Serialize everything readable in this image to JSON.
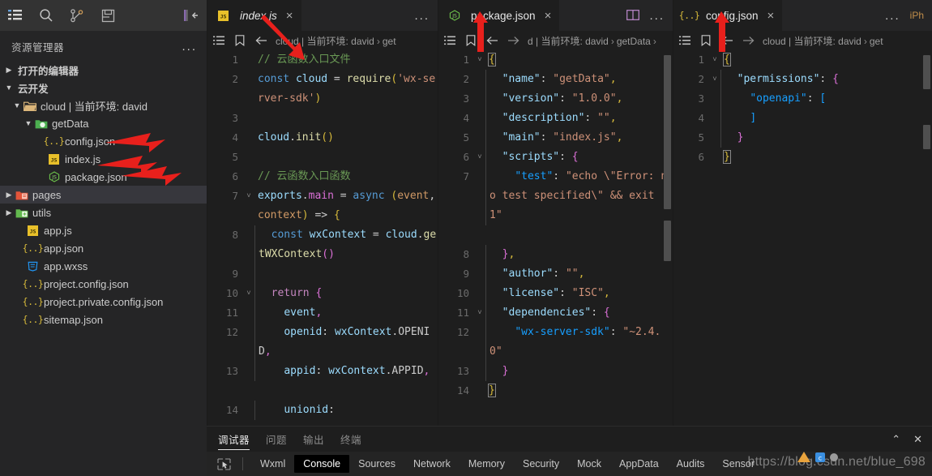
{
  "activity_bar": {
    "icons": [
      {
        "name": "explorer-icon",
        "label": "资源管理器"
      },
      {
        "name": "search-icon",
        "label": "搜索"
      },
      {
        "name": "source-control-icon",
        "label": "源代码管理"
      },
      {
        "name": "save-icon",
        "label": "保存"
      }
    ],
    "collapse_label": "折叠侧边栏"
  },
  "sidebar": {
    "title": "资源管理器",
    "more_label": "...",
    "sections": [
      {
        "label": "打开的编辑器",
        "expanded": false
      },
      {
        "label": "云开发",
        "expanded": true
      }
    ],
    "tree": [
      {
        "label": "cloud | 当前环境: david",
        "icon": "folder-open-yellow-icon",
        "depth": 1,
        "twisty": "down",
        "selected": false
      },
      {
        "label": "getData",
        "icon": "folder-open-green-icon",
        "depth": 2,
        "twisty": "down",
        "selected": false
      },
      {
        "label": "config.json",
        "icon": "json-icon",
        "depth": 3,
        "twisty": "",
        "selected": false
      },
      {
        "label": "index.js",
        "icon": "js-icon",
        "depth": 3,
        "twisty": "",
        "selected": false
      },
      {
        "label": "package.json",
        "icon": "node-icon",
        "depth": 3,
        "twisty": "",
        "selected": false
      },
      {
        "label": "pages",
        "icon": "folder-red-icon",
        "depth": 1,
        "twisty": "right",
        "selected": true
      },
      {
        "label": "utils",
        "icon": "folder-green-icon",
        "depth": 1,
        "twisty": "right",
        "selected": false
      },
      {
        "label": "app.js",
        "icon": "js-icon",
        "depth": 2,
        "twisty": "",
        "selected": false
      },
      {
        "label": "app.json",
        "icon": "json-icon",
        "depth": 2,
        "twisty": "",
        "selected": false
      },
      {
        "label": "app.wxss",
        "icon": "css-icon",
        "depth": 2,
        "twisty": "",
        "selected": false
      },
      {
        "label": "project.config.json",
        "icon": "json-icon",
        "depth": 2,
        "twisty": "",
        "selected": false
      },
      {
        "label": "project.private.config.json",
        "icon": "json-icon",
        "depth": 2,
        "twisty": "",
        "selected": false
      },
      {
        "label": "sitemap.json",
        "icon": "json-icon",
        "depth": 2,
        "twisty": "",
        "selected": false
      }
    ]
  },
  "editor_groups": [
    {
      "tab": {
        "label": "index.js",
        "icon": "js-icon",
        "active": true,
        "italic": true,
        "close": "×"
      },
      "tab_overflow": "...",
      "breadcrumb": {
        "path": "cloud | 当前环境: david",
        "sep": "›",
        "tail": "get"
      },
      "lines": [
        {
          "no": "1",
          "fold": "",
          "tokens": [
            {
              "c": "t-com",
              "t": "// 云函数入口文件"
            }
          ]
        },
        {
          "no": "2",
          "fold": "",
          "tokens": [
            {
              "c": "t-kw2",
              "t": "const"
            },
            {
              "c": "t-plain",
              "t": " "
            },
            {
              "c": "t-var",
              "t": "cloud"
            },
            {
              "c": "t-plain",
              "t": " = "
            },
            {
              "c": "t-fn",
              "t": "require"
            },
            {
              "c": "t-y",
              "t": "("
            },
            {
              "c": "t-str",
              "t": "'wx-server-sdk'"
            },
            {
              "c": "t-y",
              "t": ")"
            }
          ]
        },
        {
          "no": "3",
          "fold": "",
          "tokens": []
        },
        {
          "no": "4",
          "fold": "",
          "tokens": [
            {
              "c": "t-var",
              "t": "cloud"
            },
            {
              "c": "t-plain",
              "t": "."
            },
            {
              "c": "t-fn",
              "t": "init"
            },
            {
              "c": "t-y",
              "t": "()"
            }
          ]
        },
        {
          "no": "5",
          "fold": "",
          "tokens": []
        },
        {
          "no": "6",
          "fold": "",
          "tokens": [
            {
              "c": "t-com",
              "t": "// 云函数入口函数"
            }
          ]
        },
        {
          "no": "7",
          "fold": "v",
          "tokens": [
            {
              "c": "t-var",
              "t": "exports"
            },
            {
              "c": "t-plain",
              "t": "."
            },
            {
              "c": "t-p",
              "t": "main"
            },
            {
              "c": "t-plain",
              "t": " = "
            },
            {
              "c": "t-kw2",
              "t": "async"
            },
            {
              "c": "t-plain",
              "t": " "
            },
            {
              "c": "t-y",
              "t": "("
            },
            {
              "c": "t-orange",
              "t": "event"
            },
            {
              "c": "t-plain",
              "t": ", "
            },
            {
              "c": "t-orange",
              "t": "context"
            },
            {
              "c": "t-y",
              "t": ")"
            },
            {
              "c": "t-plain",
              "t": " => "
            },
            {
              "c": "t-y",
              "t": "{"
            }
          ]
        },
        {
          "no": "8",
          "fold": "",
          "indent": 1,
          "tokens": [
            {
              "c": "t-kw2",
              "t": "const"
            },
            {
              "c": "t-plain",
              "t": " "
            },
            {
              "c": "t-var",
              "t": "wxContext"
            },
            {
              "c": "t-plain",
              "t": " = "
            },
            {
              "c": "t-var",
              "t": "cloud"
            },
            {
              "c": "t-plain",
              "t": "."
            },
            {
              "c": "t-fn",
              "t": "getWXContext"
            },
            {
              "c": "t-p",
              "t": "()"
            }
          ]
        },
        {
          "no": "9",
          "fold": "",
          "indent": 1,
          "tokens": []
        },
        {
          "no": "10",
          "fold": "v",
          "indent": 1,
          "tokens": [
            {
              "c": "t-kw",
              "t": "return"
            },
            {
              "c": "t-plain",
              "t": " "
            },
            {
              "c": "t-p",
              "t": "{"
            }
          ]
        },
        {
          "no": "11",
          "fold": "",
          "indent": 2,
          "tokens": [
            {
              "c": "t-var",
              "t": "event"
            },
            {
              "c": "t-p",
              "t": ","
            }
          ]
        },
        {
          "no": "12",
          "fold": "",
          "indent": 2,
          "tokens": [
            {
              "c": "t-var",
              "t": "openid"
            },
            {
              "c": "t-plain",
              "t": ": "
            },
            {
              "c": "t-var",
              "t": "wxContext"
            },
            {
              "c": "t-plain",
              "t": ".OPENID"
            },
            {
              "c": "t-p",
              "t": ","
            }
          ]
        },
        {
          "no": "13",
          "fold": "",
          "indent": 2,
          "tokens": [
            {
              "c": "t-var",
              "t": "appid"
            },
            {
              "c": "t-plain",
              "t": ": "
            },
            {
              "c": "t-var",
              "t": "wxContext"
            },
            {
              "c": "t-plain",
              "t": ".APPID"
            },
            {
              "c": "t-p",
              "t": ","
            }
          ]
        },
        {
          "no": "14",
          "fold": "",
          "indent": 2,
          "tokens": [
            {
              "c": "t-var",
              "t": "unionid"
            },
            {
              "c": "t-plain",
              "t": ":"
            }
          ]
        }
      ]
    },
    {
      "tab": {
        "label": "package.json",
        "icon": "node-icon",
        "active": true,
        "italic": false,
        "close": "×"
      },
      "tab_overflow": "...",
      "split_icon": "split-editor-icon",
      "breadcrumb": {
        "path": "d | 当前环境: david",
        "sep": "›",
        "tail": "getData"
      },
      "lines": [
        {
          "no": "1",
          "fold": "v",
          "tokens": [
            {
              "c": "t-y brkt-hl",
              "t": "{"
            }
          ]
        },
        {
          "no": "2",
          "fold": "",
          "indent": 1,
          "tokens": [
            {
              "c": "t-var",
              "t": "\"name\""
            },
            {
              "c": "t-plain",
              "t": ": "
            },
            {
              "c": "t-str",
              "t": "\"getData\""
            },
            {
              "c": "t-y",
              "t": ","
            }
          ]
        },
        {
          "no": "3",
          "fold": "",
          "indent": 1,
          "tokens": [
            {
              "c": "t-var",
              "t": "\"version\""
            },
            {
              "c": "t-plain",
              "t": ": "
            },
            {
              "c": "t-str",
              "t": "\"1.0.0\""
            },
            {
              "c": "t-y",
              "t": ","
            }
          ]
        },
        {
          "no": "4",
          "fold": "",
          "indent": 1,
          "tokens": [
            {
              "c": "t-var",
              "t": "\"description\""
            },
            {
              "c": "t-plain",
              "t": ": "
            },
            {
              "c": "t-str",
              "t": "\"\""
            },
            {
              "c": "t-y",
              "t": ","
            }
          ]
        },
        {
          "no": "5",
          "fold": "",
          "indent": 1,
          "tokens": [
            {
              "c": "t-var",
              "t": "\"main\""
            },
            {
              "c": "t-plain",
              "t": ": "
            },
            {
              "c": "t-str",
              "t": "\"index.js\""
            },
            {
              "c": "t-y",
              "t": ","
            }
          ]
        },
        {
          "no": "6",
          "fold": "v",
          "indent": 1,
          "tokens": [
            {
              "c": "t-var",
              "t": "\"scripts\""
            },
            {
              "c": "t-plain",
              "t": ": "
            },
            {
              "c": "t-p",
              "t": "{"
            }
          ]
        },
        {
          "no": "7",
          "fold": "",
          "indent": 2,
          "tokens": [
            {
              "c": "t-b",
              "t": "\"test\""
            },
            {
              "c": "t-plain",
              "t": ": "
            },
            {
              "c": "t-str",
              "t": "\"echo \\\"Error: no test specified\\\" && exit 1\""
            }
          ]
        },
        {
          "no": "8",
          "fold": "",
          "indent": 1,
          "tokens": [
            {
              "c": "t-p",
              "t": "}"
            },
            {
              "c": "t-y",
              "t": ","
            }
          ]
        },
        {
          "no": "9",
          "fold": "",
          "indent": 1,
          "tokens": [
            {
              "c": "t-var",
              "t": "\"author\""
            },
            {
              "c": "t-plain",
              "t": ": "
            },
            {
              "c": "t-str",
              "t": "\"\""
            },
            {
              "c": "t-y",
              "t": ","
            }
          ]
        },
        {
          "no": "10",
          "fold": "",
          "indent": 1,
          "tokens": [
            {
              "c": "t-var",
              "t": "\"license\""
            },
            {
              "c": "t-plain",
              "t": ": "
            },
            {
              "c": "t-str",
              "t": "\"ISC\""
            },
            {
              "c": "t-y",
              "t": ","
            }
          ]
        },
        {
          "no": "11",
          "fold": "v",
          "indent": 1,
          "tokens": [
            {
              "c": "t-var",
              "t": "\"dependencies\""
            },
            {
              "c": "t-plain",
              "t": ": "
            },
            {
              "c": "t-p",
              "t": "{"
            }
          ]
        },
        {
          "no": "12",
          "fold": "",
          "indent": 2,
          "tokens": [
            {
              "c": "t-b",
              "t": "\"wx-server-sdk\""
            },
            {
              "c": "t-plain",
              "t": ": "
            },
            {
              "c": "t-str",
              "t": "\"~2.4.0\""
            }
          ]
        },
        {
          "no": "13",
          "fold": "",
          "indent": 1,
          "tokens": [
            {
              "c": "t-p",
              "t": "}"
            }
          ]
        },
        {
          "no": "14",
          "fold": "",
          "tokens": [
            {
              "c": "t-y brkt-hl",
              "t": "}"
            }
          ]
        }
      ]
    },
    {
      "tab": {
        "label": "config.json",
        "icon": "json-icon",
        "active": true,
        "italic": false,
        "close": "×"
      },
      "tab_overflow": "...",
      "breadcrumb": {
        "path": "cloud | 当前环境: david",
        "sep": "›",
        "tail": "get"
      },
      "lines": [
        {
          "no": "1",
          "fold": "v",
          "tokens": [
            {
              "c": "t-y brkt-hl",
              "t": "{"
            }
          ]
        },
        {
          "no": "2",
          "fold": "v",
          "indent": 1,
          "tokens": [
            {
              "c": "t-var",
              "t": "\"permissions\""
            },
            {
              "c": "t-plain",
              "t": ": "
            },
            {
              "c": "t-p",
              "t": "{"
            }
          ]
        },
        {
          "no": "3",
          "fold": "",
          "indent": 2,
          "tokens": [
            {
              "c": "t-b",
              "t": "\"openapi\""
            },
            {
              "c": "t-plain",
              "t": ": "
            },
            {
              "c": "t-b",
              "t": "["
            }
          ]
        },
        {
          "no": "4",
          "fold": "",
          "indent": 2,
          "tokens": [
            {
              "c": "t-b",
              "t": "]"
            }
          ]
        },
        {
          "no": "5",
          "fold": "",
          "indent": 1,
          "tokens": [
            {
              "c": "t-p",
              "t": "}"
            }
          ]
        },
        {
          "no": "6",
          "fold": "",
          "tokens": [
            {
              "c": "t-y brkt-hl",
              "t": "}"
            }
          ]
        }
      ]
    }
  ],
  "right_edge": {
    "label": "iPh"
  },
  "panel": {
    "tabs": [
      {
        "label": "调试器",
        "active": true
      },
      {
        "label": "问题",
        "active": false
      },
      {
        "label": "输出",
        "active": false
      },
      {
        "label": "终端",
        "active": false
      }
    ],
    "actions": [
      {
        "name": "chevron-up-icon",
        "glyph": "⌃"
      },
      {
        "name": "close-icon",
        "glyph": "✕"
      }
    ]
  },
  "devtools": {
    "inspect_icon": "inspect-element-icon",
    "tabs": [
      {
        "label": "Wxml",
        "active": false
      },
      {
        "label": "Console",
        "active": true
      },
      {
        "label": "Sources",
        "active": false
      },
      {
        "label": "Network",
        "active": false
      },
      {
        "label": "Memory",
        "active": false
      },
      {
        "label": "Security",
        "active": false
      },
      {
        "label": "Mock",
        "active": false
      },
      {
        "label": "AppData",
        "active": false
      },
      {
        "label": "Audits",
        "active": false
      },
      {
        "label": "Sensor",
        "active": false
      }
    ]
  },
  "watermark": {
    "text": "https://blog.csdn.net/blue_698"
  },
  "annotations": {
    "arrow_color": "#e8201c",
    "arrows": [
      "points-at-index-js-tab",
      "points-at-config-json-file",
      "points-at-index-js-file",
      "points-at-package-json-file",
      "points-at-package-json-tab",
      "points-at-config-json-tab"
    ]
  },
  "colors": {
    "bg": "#1e1e1e",
    "sidebar_bg": "#252526",
    "titlebar_bg": "#333333",
    "tab_inactive": "#2d2d2d",
    "selection": "#37373d",
    "accent_yellow": "#d7ba3b",
    "accent_green": "#6A9955",
    "accent_string": "#CE9178",
    "arrow_red": "#e8201c"
  }
}
